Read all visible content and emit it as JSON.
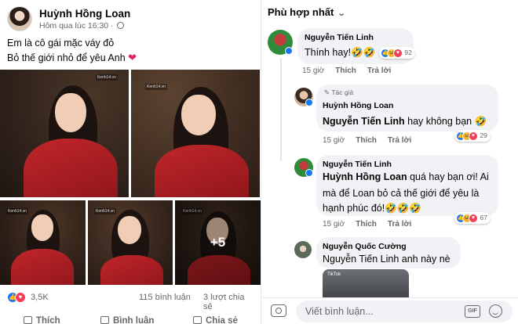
{
  "post": {
    "author": "Huỳnh Hồng Loan",
    "time": "Hôm qua lúc 16:30",
    "line1": "Em là cô gái mặc váy đỏ",
    "line2": "Bỏ thế giới nhỏ để yêu Anh",
    "heart": "❤️",
    "watermark": "Kenh14.vn",
    "more_photos": "+5",
    "reactions_count": "3,5K",
    "comments_count": "115 bình luận",
    "shares_count": "3 lượt chia sẻ",
    "actions": {
      "like": "Thích",
      "comment": "Bình luận",
      "share": "Chia sẻ"
    }
  },
  "comments_panel": {
    "sort_label": "Phù hợp nhất",
    "comments": [
      {
        "author": "Nguyễn Tiến Linh",
        "text": "Thính hay!🤣🤣",
        "time": "15 giờ",
        "like": "Thích",
        "reply": "Trả lời",
        "reactions": "92"
      },
      {
        "author_tag": "Tác giả",
        "author": "Huỳnh Hồng Loan",
        "mention": "Nguyễn Tiến Linh",
        "text": " hay không bạn 🤣",
        "time": "15 giờ",
        "like": "Thích",
        "reply": "Trả lời",
        "reactions": "29"
      },
      {
        "author": "Nguyễn Tiến Linh",
        "mention": "Huỳnh Hồng Loan",
        "text_line1": " quá hay bạn ơi! Ai",
        "text_line2": "mà để Loan bỏ cả thế giới để yêu là",
        "text_line3": "hạnh phúc đó!🤣🤣🤣",
        "time": "15 giờ",
        "like": "Thích",
        "reply": "Trả lời",
        "reactions": "67"
      },
      {
        "author": "Nguyễn Quốc Cường",
        "text": "Nguyễn Tiến Linh anh này nè",
        "attachment_label": "TikTok"
      }
    ],
    "composer_placeholder": "Viết bình luận...",
    "gif_label": "GIF"
  }
}
